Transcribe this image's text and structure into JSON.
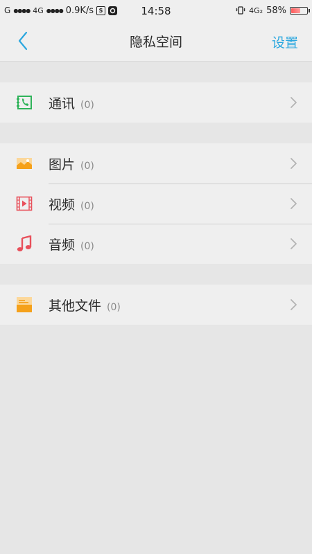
{
  "status_bar": {
    "carrier_left": "G",
    "signal_dots_1": "●●●●",
    "network_1": "4G",
    "signal_dots_2": "●●●●",
    "speed": "0.9K/s",
    "box_icon_1": "S",
    "time": "14:58",
    "network_right": "4G₂",
    "battery_percent": "58%",
    "battery_level": 0.58
  },
  "nav": {
    "title": "隐私空间",
    "settings_label": "设置"
  },
  "groups": [
    {
      "items": [
        {
          "label": "通讯",
          "count": "(0)",
          "icon": "contacts-icon",
          "color": "#2fb35a"
        }
      ]
    },
    {
      "items": [
        {
          "label": "图片",
          "count": "(0)",
          "icon": "picture-icon",
          "color": "#f5a11a"
        },
        {
          "label": "视频",
          "count": "(0)",
          "icon": "video-icon",
          "color": "#e8505b"
        },
        {
          "label": "音频",
          "count": "(0)",
          "icon": "music-icon",
          "color": "#e8505b"
        }
      ]
    },
    {
      "items": [
        {
          "label": "其他文件",
          "count": "(0)",
          "icon": "folder-icon",
          "color": "#f5a11a"
        }
      ]
    }
  ],
  "colors": {
    "accent": "#2aa7df",
    "background": "#e6e6e6",
    "group_background": "#efefef"
  }
}
